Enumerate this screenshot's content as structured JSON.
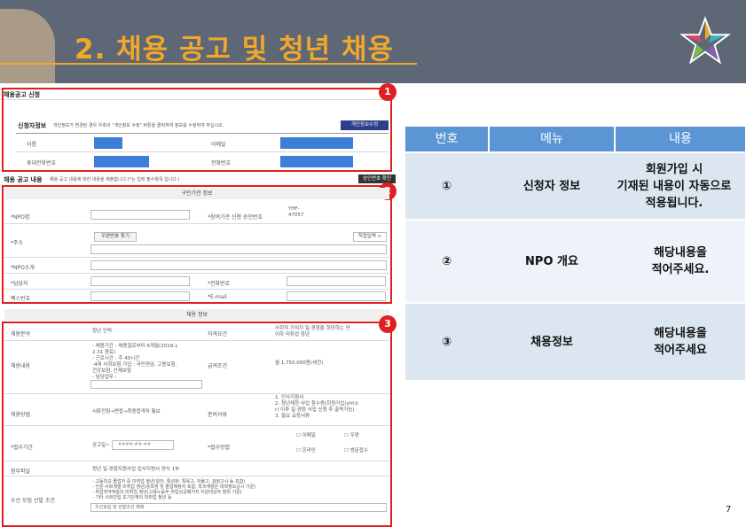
{
  "slide": {
    "title": "2. 채용 공고 및 청년 채용",
    "page_number": "7",
    "accent_color": "#f2a72b",
    "banner_color": "#5e6776"
  },
  "form": {
    "apply_title": "채용공고 신청",
    "applicant_section": {
      "title": "신청자정보",
      "note": "개인정보가 변경된 경우 우측의 \"개인정보 수정\" 버튼을 클릭하여 정보를 수정하여 주십시오.",
      "edit_button": "개인정보수정",
      "name_label": "이름",
      "email_label": "이메일",
      "mobile_label": "휴대전화번호",
      "phone_label": "전화번호",
      "badge": "1"
    },
    "posting_section": {
      "title": "채용 공고 내용",
      "note": "채용 공고 내용에 대한 내용을 제출합니다.(*는 입력 필수항목 입니다.)",
      "confirm_button": "승인번호 확인",
      "org_info_header": "구인기관 정보",
      "badge": "2",
      "npo_label": "*NPO명",
      "approval_label": "*참여기관 신청 승인번호",
      "approval_value": "YHF-\n47057",
      "address_label": "*주소",
      "postcode_button": "우편번호 찾기",
      "direct_input_button": "직접입력 >",
      "npo_intro_label": "*NPO소개",
      "manager_label": "*담당자",
      "phone_label": "*전화번호",
      "fax_label": "팩스번호",
      "email_label": "*E-mail"
    },
    "recruit_section": {
      "header": "채용 정보",
      "badge": "3",
      "field_label": "채용분야",
      "field_value": "청년 인력",
      "qualification_label": "자격요건",
      "qualification_value": "사회적 가치지 일·경험을 희망하는 만\n이하 미취업 청년",
      "content_label": "채용내용",
      "content_value": "- 채용기간 : 채용일로부터 6개월(2019.1\n2.31 종료)\n- 근로시간 : 주 40시간\n-4대 사회보험 가입 : 국민연금, 고용보험,\n                    건강보험, 산재보험\n- 담당업무 :",
      "salary_label": "급여조건",
      "salary_value": "월 1,750,000원(세전)",
      "method_label": "채용방법",
      "method_value": "서류전형→면접→최종합격자 통보",
      "documents_label": "준비서류",
      "documents_value": "1. 인사지원서\n2. 청년채한 사업 참수증(회원가입(yhf.k\nr) 이후 일·경험 사업 신청 후 출력가능)\n3. 필요 요청서류",
      "period_label": "*접수기간",
      "period_value": "공고일~",
      "period_placeholder": "####-##-##",
      "receipt_label": "*접수방법",
      "receipt_options": [
        "이메일",
        "우편",
        "온라인",
        "방문접수"
      ],
      "attachment_label": "첨부파일",
      "attachment_value": "청년 일·경험지원사업 입사지원서 양식 1부",
      "priority_label": "우선 모집 선발 조건",
      "priority_value": "- 고등학교 졸업자 중 미취업 청년(일반, 특성화, 특목고, 자율고, 검정고시 등 포함)\n- 인문·사회계열 미취업 청년(중학생 및 졸업예정자 포함, 학과계열은 대학정보공시 기준)\n- 취업취약계층의 미취업 청년(고용노동부 취업성공패키지 지원대상자 범위 기준)\n- 기타 사회진입 초기단계의 미취업 청년 등",
      "priority_placeholder": "우선모집 및 선발조건 예제"
    }
  },
  "table": {
    "headers": [
      "번호",
      "메뉴",
      "내용"
    ],
    "header_color": "#5b95d3",
    "rows": [
      {
        "num": "①",
        "menu": "신청자 정보",
        "content": "회원가입 시\n기재된 내용이 자동으로\n적용됩니다."
      },
      {
        "num": "②",
        "menu": "NPO 개요",
        "content": "해당내용을\n적어주세요."
      },
      {
        "num": "③",
        "menu": "채용정보",
        "content": "해당내용을\n적어주세요"
      }
    ]
  }
}
